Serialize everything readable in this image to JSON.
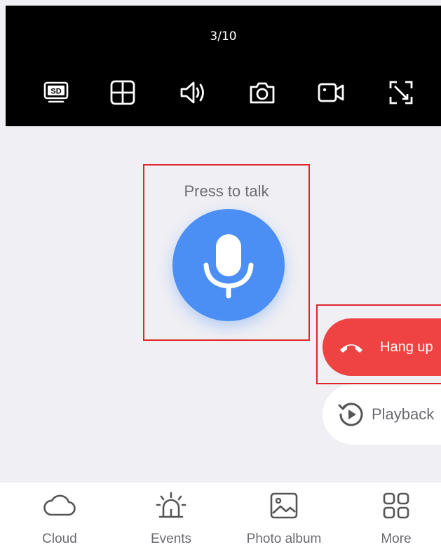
{
  "player": {
    "page_counter": "3/10"
  },
  "controls": [
    {
      "name": "sd-quality-icon"
    },
    {
      "name": "grid-layout-icon"
    },
    {
      "name": "speaker-icon"
    },
    {
      "name": "camera-snapshot-icon"
    },
    {
      "name": "video-record-icon"
    },
    {
      "name": "fullscreen-icon"
    }
  ],
  "talk": {
    "label": "Press to talk",
    "icon": "microphone-icon",
    "accent": "#4b8ff5"
  },
  "actions": {
    "hang_up_label": "Hang up",
    "hang_up_color": "#ef4343",
    "playback_label": "Playback"
  },
  "nav": {
    "cloud": "Cloud",
    "events": "Events",
    "photo_album": "Photo album",
    "more": "More"
  },
  "sd_badge": "SD"
}
